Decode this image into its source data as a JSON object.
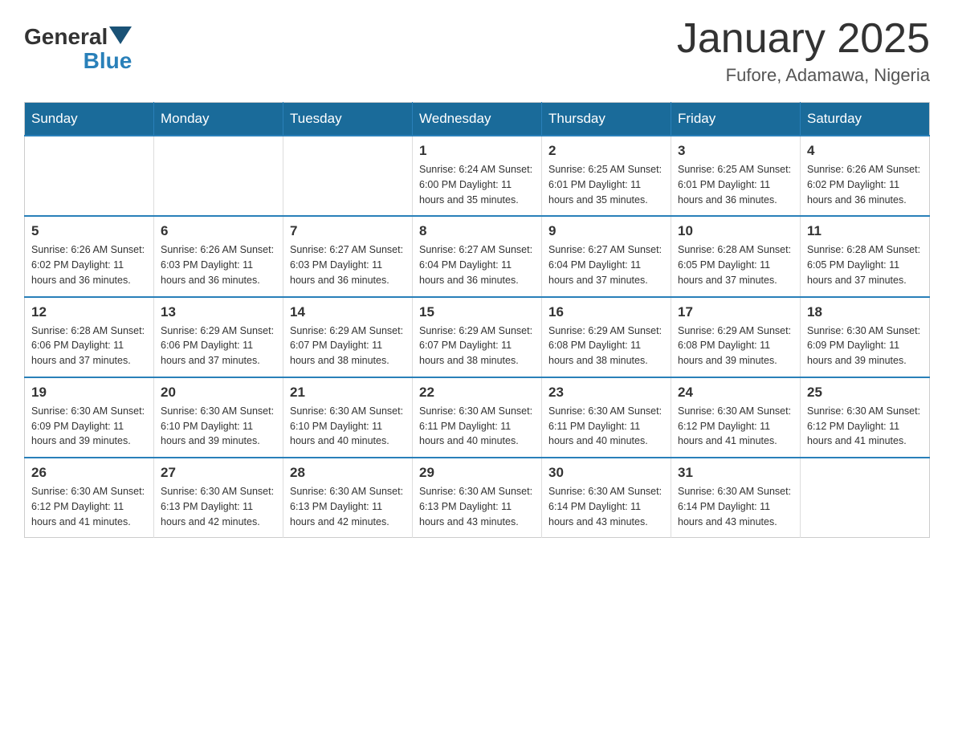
{
  "logo": {
    "general": "General",
    "triangle": "",
    "blue": "Blue"
  },
  "title": "January 2025",
  "location": "Fufore, Adamawa, Nigeria",
  "days_of_week": [
    "Sunday",
    "Monday",
    "Tuesday",
    "Wednesday",
    "Thursday",
    "Friday",
    "Saturday"
  ],
  "weeks": [
    [
      {
        "day": "",
        "info": ""
      },
      {
        "day": "",
        "info": ""
      },
      {
        "day": "",
        "info": ""
      },
      {
        "day": "1",
        "info": "Sunrise: 6:24 AM\nSunset: 6:00 PM\nDaylight: 11 hours and 35 minutes."
      },
      {
        "day": "2",
        "info": "Sunrise: 6:25 AM\nSunset: 6:01 PM\nDaylight: 11 hours and 35 minutes."
      },
      {
        "day": "3",
        "info": "Sunrise: 6:25 AM\nSunset: 6:01 PM\nDaylight: 11 hours and 36 minutes."
      },
      {
        "day": "4",
        "info": "Sunrise: 6:26 AM\nSunset: 6:02 PM\nDaylight: 11 hours and 36 minutes."
      }
    ],
    [
      {
        "day": "5",
        "info": "Sunrise: 6:26 AM\nSunset: 6:02 PM\nDaylight: 11 hours and 36 minutes."
      },
      {
        "day": "6",
        "info": "Sunrise: 6:26 AM\nSunset: 6:03 PM\nDaylight: 11 hours and 36 minutes."
      },
      {
        "day": "7",
        "info": "Sunrise: 6:27 AM\nSunset: 6:03 PM\nDaylight: 11 hours and 36 minutes."
      },
      {
        "day": "8",
        "info": "Sunrise: 6:27 AM\nSunset: 6:04 PM\nDaylight: 11 hours and 36 minutes."
      },
      {
        "day": "9",
        "info": "Sunrise: 6:27 AM\nSunset: 6:04 PM\nDaylight: 11 hours and 37 minutes."
      },
      {
        "day": "10",
        "info": "Sunrise: 6:28 AM\nSunset: 6:05 PM\nDaylight: 11 hours and 37 minutes."
      },
      {
        "day": "11",
        "info": "Sunrise: 6:28 AM\nSunset: 6:05 PM\nDaylight: 11 hours and 37 minutes."
      }
    ],
    [
      {
        "day": "12",
        "info": "Sunrise: 6:28 AM\nSunset: 6:06 PM\nDaylight: 11 hours and 37 minutes."
      },
      {
        "day": "13",
        "info": "Sunrise: 6:29 AM\nSunset: 6:06 PM\nDaylight: 11 hours and 37 minutes."
      },
      {
        "day": "14",
        "info": "Sunrise: 6:29 AM\nSunset: 6:07 PM\nDaylight: 11 hours and 38 minutes."
      },
      {
        "day": "15",
        "info": "Sunrise: 6:29 AM\nSunset: 6:07 PM\nDaylight: 11 hours and 38 minutes."
      },
      {
        "day": "16",
        "info": "Sunrise: 6:29 AM\nSunset: 6:08 PM\nDaylight: 11 hours and 38 minutes."
      },
      {
        "day": "17",
        "info": "Sunrise: 6:29 AM\nSunset: 6:08 PM\nDaylight: 11 hours and 39 minutes."
      },
      {
        "day": "18",
        "info": "Sunrise: 6:30 AM\nSunset: 6:09 PM\nDaylight: 11 hours and 39 minutes."
      }
    ],
    [
      {
        "day": "19",
        "info": "Sunrise: 6:30 AM\nSunset: 6:09 PM\nDaylight: 11 hours and 39 minutes."
      },
      {
        "day": "20",
        "info": "Sunrise: 6:30 AM\nSunset: 6:10 PM\nDaylight: 11 hours and 39 minutes."
      },
      {
        "day": "21",
        "info": "Sunrise: 6:30 AM\nSunset: 6:10 PM\nDaylight: 11 hours and 40 minutes."
      },
      {
        "day": "22",
        "info": "Sunrise: 6:30 AM\nSunset: 6:11 PM\nDaylight: 11 hours and 40 minutes."
      },
      {
        "day": "23",
        "info": "Sunrise: 6:30 AM\nSunset: 6:11 PM\nDaylight: 11 hours and 40 minutes."
      },
      {
        "day": "24",
        "info": "Sunrise: 6:30 AM\nSunset: 6:12 PM\nDaylight: 11 hours and 41 minutes."
      },
      {
        "day": "25",
        "info": "Sunrise: 6:30 AM\nSunset: 6:12 PM\nDaylight: 11 hours and 41 minutes."
      }
    ],
    [
      {
        "day": "26",
        "info": "Sunrise: 6:30 AM\nSunset: 6:12 PM\nDaylight: 11 hours and 41 minutes."
      },
      {
        "day": "27",
        "info": "Sunrise: 6:30 AM\nSunset: 6:13 PM\nDaylight: 11 hours and 42 minutes."
      },
      {
        "day": "28",
        "info": "Sunrise: 6:30 AM\nSunset: 6:13 PM\nDaylight: 11 hours and 42 minutes."
      },
      {
        "day": "29",
        "info": "Sunrise: 6:30 AM\nSunset: 6:13 PM\nDaylight: 11 hours and 43 minutes."
      },
      {
        "day": "30",
        "info": "Sunrise: 6:30 AM\nSunset: 6:14 PM\nDaylight: 11 hours and 43 minutes."
      },
      {
        "day": "31",
        "info": "Sunrise: 6:30 AM\nSunset: 6:14 PM\nDaylight: 11 hours and 43 minutes."
      },
      {
        "day": "",
        "info": ""
      }
    ]
  ]
}
